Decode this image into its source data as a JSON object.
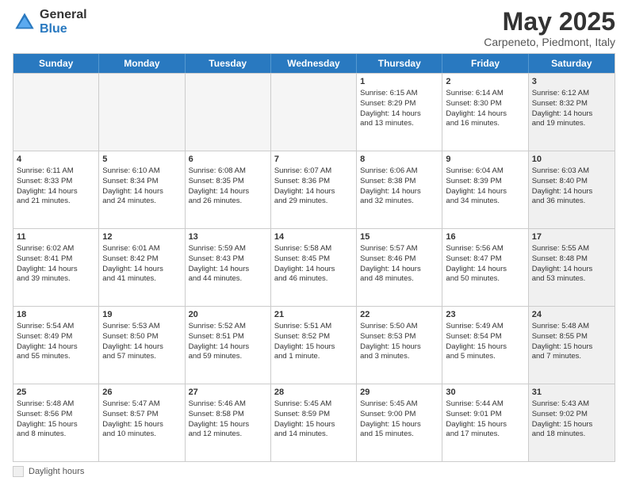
{
  "logo": {
    "general": "General",
    "blue": "Blue"
  },
  "title": "May 2025",
  "subtitle": "Carpeneto, Piedmont, Italy",
  "header_days": [
    "Sunday",
    "Monday",
    "Tuesday",
    "Wednesday",
    "Thursday",
    "Friday",
    "Saturday"
  ],
  "legend": {
    "box_label": "Daylight hours"
  },
  "weeks": [
    [
      {
        "day": "",
        "empty": true,
        "info": ""
      },
      {
        "day": "",
        "empty": true,
        "info": ""
      },
      {
        "day": "",
        "empty": true,
        "info": ""
      },
      {
        "day": "",
        "empty": true,
        "info": ""
      },
      {
        "day": "1",
        "empty": false,
        "info": "Sunrise: 6:15 AM\nSunset: 8:29 PM\nDaylight: 14 hours\nand 13 minutes."
      },
      {
        "day": "2",
        "empty": false,
        "info": "Sunrise: 6:14 AM\nSunset: 8:30 PM\nDaylight: 14 hours\nand 16 minutes."
      },
      {
        "day": "3",
        "empty": false,
        "shaded": true,
        "info": "Sunrise: 6:12 AM\nSunset: 8:32 PM\nDaylight: 14 hours\nand 19 minutes."
      }
    ],
    [
      {
        "day": "4",
        "empty": false,
        "info": "Sunrise: 6:11 AM\nSunset: 8:33 PM\nDaylight: 14 hours\nand 21 minutes."
      },
      {
        "day": "5",
        "empty": false,
        "info": "Sunrise: 6:10 AM\nSunset: 8:34 PM\nDaylight: 14 hours\nand 24 minutes."
      },
      {
        "day": "6",
        "empty": false,
        "info": "Sunrise: 6:08 AM\nSunset: 8:35 PM\nDaylight: 14 hours\nand 26 minutes."
      },
      {
        "day": "7",
        "empty": false,
        "info": "Sunrise: 6:07 AM\nSunset: 8:36 PM\nDaylight: 14 hours\nand 29 minutes."
      },
      {
        "day": "8",
        "empty": false,
        "info": "Sunrise: 6:06 AM\nSunset: 8:38 PM\nDaylight: 14 hours\nand 32 minutes."
      },
      {
        "day": "9",
        "empty": false,
        "info": "Sunrise: 6:04 AM\nSunset: 8:39 PM\nDaylight: 14 hours\nand 34 minutes."
      },
      {
        "day": "10",
        "empty": false,
        "shaded": true,
        "info": "Sunrise: 6:03 AM\nSunset: 8:40 PM\nDaylight: 14 hours\nand 36 minutes."
      }
    ],
    [
      {
        "day": "11",
        "empty": false,
        "info": "Sunrise: 6:02 AM\nSunset: 8:41 PM\nDaylight: 14 hours\nand 39 minutes."
      },
      {
        "day": "12",
        "empty": false,
        "info": "Sunrise: 6:01 AM\nSunset: 8:42 PM\nDaylight: 14 hours\nand 41 minutes."
      },
      {
        "day": "13",
        "empty": false,
        "info": "Sunrise: 5:59 AM\nSunset: 8:43 PM\nDaylight: 14 hours\nand 44 minutes."
      },
      {
        "day": "14",
        "empty": false,
        "info": "Sunrise: 5:58 AM\nSunset: 8:45 PM\nDaylight: 14 hours\nand 46 minutes."
      },
      {
        "day": "15",
        "empty": false,
        "info": "Sunrise: 5:57 AM\nSunset: 8:46 PM\nDaylight: 14 hours\nand 48 minutes."
      },
      {
        "day": "16",
        "empty": false,
        "info": "Sunrise: 5:56 AM\nSunset: 8:47 PM\nDaylight: 14 hours\nand 50 minutes."
      },
      {
        "day": "17",
        "empty": false,
        "shaded": true,
        "info": "Sunrise: 5:55 AM\nSunset: 8:48 PM\nDaylight: 14 hours\nand 53 minutes."
      }
    ],
    [
      {
        "day": "18",
        "empty": false,
        "info": "Sunrise: 5:54 AM\nSunset: 8:49 PM\nDaylight: 14 hours\nand 55 minutes."
      },
      {
        "day": "19",
        "empty": false,
        "info": "Sunrise: 5:53 AM\nSunset: 8:50 PM\nDaylight: 14 hours\nand 57 minutes."
      },
      {
        "day": "20",
        "empty": false,
        "info": "Sunrise: 5:52 AM\nSunset: 8:51 PM\nDaylight: 14 hours\nand 59 minutes."
      },
      {
        "day": "21",
        "empty": false,
        "info": "Sunrise: 5:51 AM\nSunset: 8:52 PM\nDaylight: 15 hours\nand 1 minute."
      },
      {
        "day": "22",
        "empty": false,
        "info": "Sunrise: 5:50 AM\nSunset: 8:53 PM\nDaylight: 15 hours\nand 3 minutes."
      },
      {
        "day": "23",
        "empty": false,
        "info": "Sunrise: 5:49 AM\nSunset: 8:54 PM\nDaylight: 15 hours\nand 5 minutes."
      },
      {
        "day": "24",
        "empty": false,
        "shaded": true,
        "info": "Sunrise: 5:48 AM\nSunset: 8:55 PM\nDaylight: 15 hours\nand 7 minutes."
      }
    ],
    [
      {
        "day": "25",
        "empty": false,
        "info": "Sunrise: 5:48 AM\nSunset: 8:56 PM\nDaylight: 15 hours\nand 8 minutes."
      },
      {
        "day": "26",
        "empty": false,
        "info": "Sunrise: 5:47 AM\nSunset: 8:57 PM\nDaylight: 15 hours\nand 10 minutes."
      },
      {
        "day": "27",
        "empty": false,
        "info": "Sunrise: 5:46 AM\nSunset: 8:58 PM\nDaylight: 15 hours\nand 12 minutes."
      },
      {
        "day": "28",
        "empty": false,
        "info": "Sunrise: 5:45 AM\nSunset: 8:59 PM\nDaylight: 15 hours\nand 14 minutes."
      },
      {
        "day": "29",
        "empty": false,
        "info": "Sunrise: 5:45 AM\nSunset: 9:00 PM\nDaylight: 15 hours\nand 15 minutes."
      },
      {
        "day": "30",
        "empty": false,
        "info": "Sunrise: 5:44 AM\nSunset: 9:01 PM\nDaylight: 15 hours\nand 17 minutes."
      },
      {
        "day": "31",
        "empty": false,
        "shaded": true,
        "info": "Sunrise: 5:43 AM\nSunset: 9:02 PM\nDaylight: 15 hours\nand 18 minutes."
      }
    ]
  ]
}
